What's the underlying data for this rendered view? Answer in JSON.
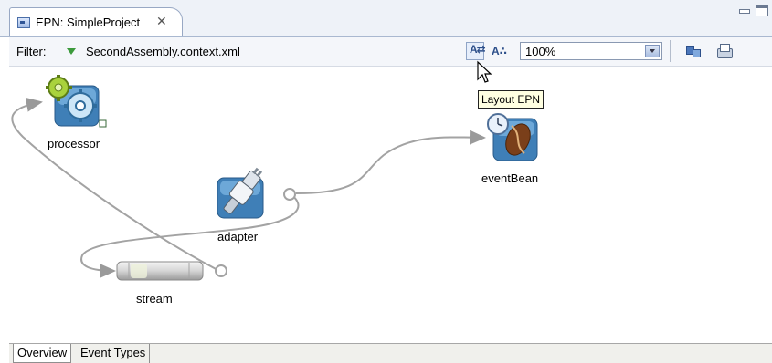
{
  "editor": {
    "tab_title": "EPN: SimpleProject",
    "close_glyph": "✕"
  },
  "toolbar": {
    "filter_label": "Filter:",
    "filter_value": "SecondAssembly.context.xml",
    "zoom_value": "100%",
    "layout_icon": "layout-epn-icon",
    "zoom_icon": "zoom-icon",
    "layout_glyph": "A⇄",
    "zoom_glyph": "A∴"
  },
  "tooltip": {
    "text": "Layout EPN"
  },
  "nodes": [
    {
      "id": "processor",
      "label": "processor",
      "icon": "gear-icon"
    },
    {
      "id": "adapter",
      "label": "adapter",
      "icon": "plug-adapter-icon"
    },
    {
      "id": "stream",
      "label": "stream",
      "icon": "stream-pipe-icon"
    },
    {
      "id": "eventBean",
      "label": "eventBean",
      "icon": "coffee-bean-clock-icon"
    }
  ],
  "bottom_tabs": [
    {
      "label": "Overview",
      "selected": true
    },
    {
      "label": "Event Types",
      "selected": false
    }
  ],
  "colors": {
    "wire": "#a3a3a3",
    "tab_border": "#98a8c4",
    "tooltip_bg": "#ffffe1"
  }
}
